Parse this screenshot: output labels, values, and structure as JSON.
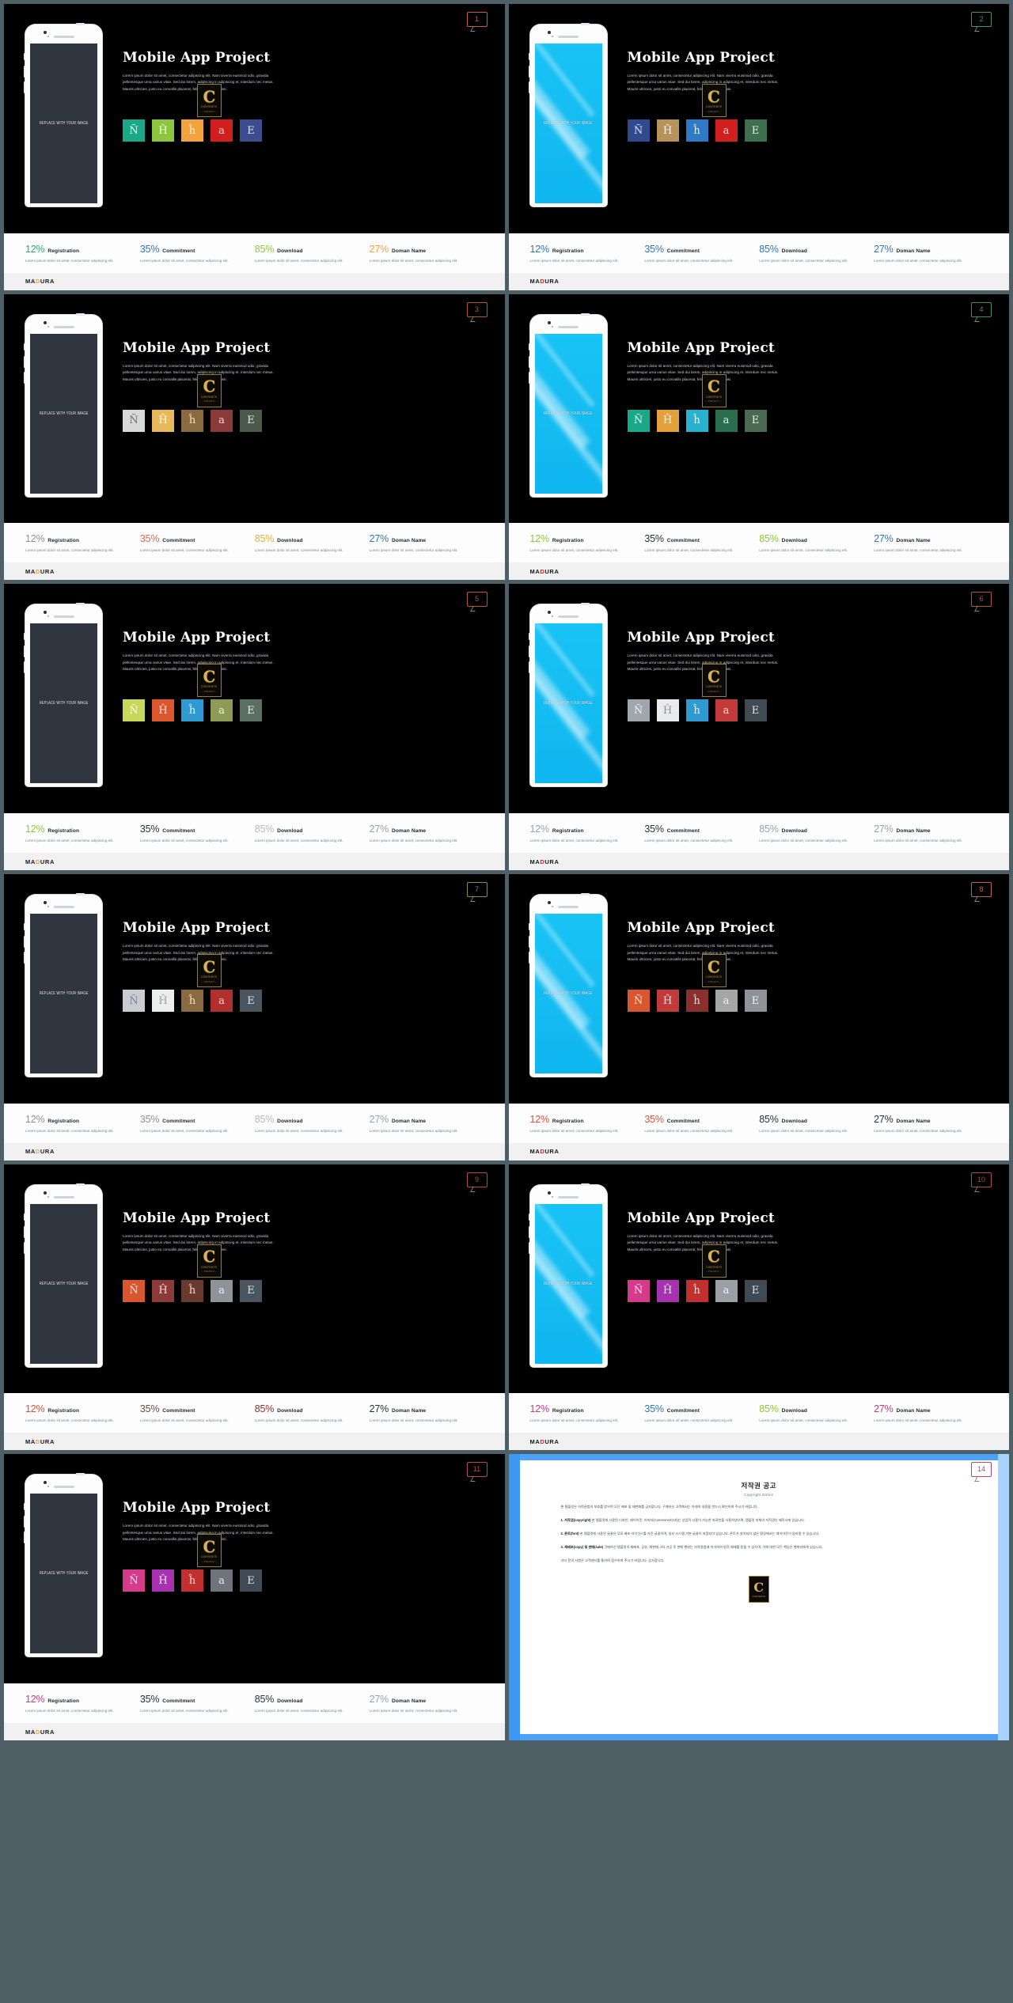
{
  "deck": {
    "title": "Mobile App Project",
    "body_copy": "Lorem ipsum dolor sit amet, consectetur adipiscing elit. Nam viverra euismod odio, gravida pellentesque urna varius vitae. Sed dui lorem, adipiscing in adipiscing et, interdum nec metus. Mauris ultricies, justo eu convallis placerat, felis enim ornare nisi.",
    "phone_label": "REPLACE WITH YOUR IMAGE",
    "brand": {
      "pre": "MA",
      "accent": "D",
      "post": "URA"
    },
    "seal": {
      "letter": "C",
      "line1": "CONTENTS",
      "line2": "~ PRESENT ~"
    },
    "stat_labels": [
      "Registration",
      "Commitment",
      "Download",
      "Doman Name"
    ],
    "stat_values": [
      "12%",
      "35%",
      "85%",
      "27%"
    ],
    "stat_sub": "Lorem ipsum dolor sit amet, consectetur adipiscing elit.",
    "tile_letters": [
      "Ñ",
      "Ĥ",
      "ĥ",
      "a",
      "E"
    ]
  },
  "slides": [
    {
      "badge": "1",
      "badge_color": "#c0643f",
      "screen": "dark",
      "stat_colors": [
        "#2aa876",
        "#2f74b5",
        "#8cc63f",
        "#f2a33c"
      ],
      "tiles": [
        {
          "bg": "#19a888",
          "fg": "#eaf7f3"
        },
        {
          "bg": "#8cc63f",
          "fg": "#f2f9e7"
        },
        {
          "bg": "#f2a33c",
          "fg": "#fff4e4"
        },
        {
          "bg": "#d11f1f",
          "fg": "#ffdcdc"
        },
        {
          "bg": "#3b4d8f",
          "fg": "#dfe4f7"
        }
      ]
    },
    {
      "badge": "2",
      "badge_color": "#4c8f74",
      "screen": "blue",
      "stat_colors": [
        "#2f74b5",
        "#2f74b5",
        "#2f74b5",
        "#2f74b5"
      ],
      "tiles": [
        {
          "bg": "#2f4a8f",
          "fg": "#dfe4f7"
        },
        {
          "bg": "#b7935a",
          "fg": "#fdf6e9"
        },
        {
          "bg": "#2f7ac4",
          "fg": "#e4f0fb"
        },
        {
          "bg": "#d11f1f",
          "fg": "#ffdcdc"
        },
        {
          "bg": "#3f6f4e",
          "fg": "#e2f0e6"
        }
      ]
    },
    {
      "badge": "3",
      "badge_color": "#b0593a",
      "screen": "dark",
      "stat_colors": [
        "#8f8f8f",
        "#d16b5a",
        "#e0b23c",
        "#2f74b5"
      ],
      "tiles": [
        {
          "bg": "#d8d8d8",
          "fg": "#6d6d6d"
        },
        {
          "bg": "#e6b95c",
          "fg": "#fff6e0"
        },
        {
          "bg": "#8a6a3f",
          "fg": "#f0e4d0"
        },
        {
          "bg": "#8b3a3a",
          "fg": "#f5dada"
        },
        {
          "bg": "#4a5a4a",
          "fg": "#e2eae2"
        }
      ]
    },
    {
      "badge": "4",
      "badge_color": "#3e8f63",
      "screen": "blue",
      "stat_colors": [
        "#8cc63f",
        "#2b2f33",
        "#8cc63f",
        "#2f74b5"
      ],
      "tiles": [
        {
          "bg": "#19a888",
          "fg": "#eaf7f3"
        },
        {
          "bg": "#e2a13a",
          "fg": "#fff2dd"
        },
        {
          "bg": "#29b2cf",
          "fg": "#e4f7fb"
        },
        {
          "bg": "#2a6e4e",
          "fg": "#e0f0e7"
        },
        {
          "bg": "#4a6a52",
          "fg": "#e6efe9"
        }
      ]
    },
    {
      "badge": "5",
      "badge_color": "#b0593a",
      "screen": "dark",
      "stat_colors": [
        "#8cc63f",
        "#2b2f33",
        "#b7b7b7",
        "#9aa0a6"
      ],
      "tiles": [
        {
          "bg": "#c8d85a",
          "fg": "#f6f9e2"
        },
        {
          "bg": "#d9562f",
          "fg": "#ffe2d8"
        },
        {
          "bg": "#2f9ad1",
          "fg": "#e2f2fb"
        },
        {
          "bg": "#8e9a58",
          "fg": "#f0f4de"
        },
        {
          "bg": "#5a6f5f",
          "fg": "#e8efea"
        }
      ]
    },
    {
      "badge": "6",
      "badge_color": "#b0593a",
      "screen": "blue",
      "stat_colors": [
        "#9aa0a6",
        "#2b2f33",
        "#9aa0a6",
        "#9aa0a6"
      ],
      "tiles": [
        {
          "bg": "#9fa6ac",
          "fg": "#f0f2f4"
        },
        {
          "bg": "#e9eaec",
          "fg": "#8d9399"
        },
        {
          "bg": "#2f9ad1",
          "fg": "#e2f2fb"
        },
        {
          "bg": "#c33a3a",
          "fg": "#ffdede"
        },
        {
          "bg": "#3f4a55",
          "fg": "#dfe4ea"
        }
      ]
    },
    {
      "badge": "7",
      "badge_color": "#8c8c4a",
      "screen": "dark",
      "stat_colors": [
        "#8f8f8f",
        "#8f8f8f",
        "#b7b7b7",
        "#9aa0a6"
      ],
      "tiles": [
        {
          "bg": "#c9cdd1",
          "fg": "#7d8388"
        },
        {
          "bg": "#eceded",
          "fg": "#9aa0a4"
        },
        {
          "bg": "#8a6a3f",
          "fg": "#f0e4d0"
        },
        {
          "bg": "#b03030",
          "fg": "#ffdada"
        },
        {
          "bg": "#4a5560",
          "fg": "#e1e6eb"
        }
      ]
    },
    {
      "badge": "8",
      "badge_color": "#c0643f",
      "screen": "blue",
      "stat_colors": [
        "#d4543a",
        "#d4543a",
        "#2b2f33",
        "#2b2f33"
      ],
      "tiles": [
        {
          "bg": "#d9562f",
          "fg": "#ffe2d8"
        },
        {
          "bg": "#c33a3a",
          "fg": "#ffdede"
        },
        {
          "bg": "#8b2f2f",
          "fg": "#f7d6d6"
        },
        {
          "bg": "#a6a6a6",
          "fg": "#efefef"
        },
        {
          "bg": "#8d9399",
          "fg": "#f2f4f6"
        }
      ]
    },
    {
      "badge": "9",
      "badge_color": "#b34a4a",
      "screen": "dark",
      "stat_colors": [
        "#d4543a",
        "#6b4a3a",
        "#8b2f2f",
        "#2b2f33"
      ],
      "tiles": [
        {
          "bg": "#d9562f",
          "fg": "#ffe2d8"
        },
        {
          "bg": "#8b3a3a",
          "fg": "#f5dada"
        },
        {
          "bg": "#6b3a2f",
          "fg": "#f0ddd4"
        },
        {
          "bg": "#8d9399",
          "fg": "#f2f4f6"
        },
        {
          "bg": "#4a5560",
          "fg": "#e1e6eb"
        }
      ]
    },
    {
      "badge": "10",
      "badge_color": "#b34a4a",
      "screen": "blue",
      "stat_colors": [
        "#c43a7a",
        "#2f74b5",
        "#8cc63f",
        "#c43a7a"
      ],
      "tiles": [
        {
          "bg": "#d63a8a",
          "fg": "#ffdff0"
        },
        {
          "bg": "#a632b0",
          "fg": "#f6dcf8"
        },
        {
          "bg": "#c12f2f",
          "fg": "#ffdcdc"
        },
        {
          "bg": "#9aa0a6",
          "fg": "#f0f2f4"
        },
        {
          "bg": "#3f4a55",
          "fg": "#dfe4ea"
        }
      ]
    },
    {
      "badge": "11",
      "badge_color": "#b34a4a",
      "screen": "dark",
      "stat_colors": [
        "#c43a7a",
        "#2b2f33",
        "#2b2f33",
        "#9aa0a6"
      ],
      "tiles": [
        {
          "bg": "#d63a8a",
          "fg": "#ffdff0"
        },
        {
          "bg": "#a632b0",
          "fg": "#f6dcf8"
        },
        {
          "bg": "#c12f2f",
          "fg": "#ffdcdc"
        },
        {
          "bg": "#6e7479",
          "fg": "#e9ebed"
        },
        {
          "bg": "#3f4a55",
          "fg": "#dfe4ea"
        }
      ]
    }
  ],
  "doc": {
    "badge": "14",
    "badge_color": "#b3486e",
    "title": "저작권 공고",
    "subtitle": "Copyright Notice",
    "intro": "본 템플릿은 저작권법의 보호를 받으며 무단 배포 및 재판매를 금지합니다. 구매하신 고객께서는 아래의 내용을 반드시 확인하여 주시기 바랍니다.",
    "p1_head": "1. 저작권(copyright)",
    "p1": "본 템플릿에 사용된 디자인, 레이아웃, 이미지(Commons/CC0)는 상업적 사용이 가능한 자료만을 사용하였으며, 템플릿 자체의 저작권은 제작사에 있습니다.",
    "p2_head": "2. 폰트(font)",
    "p2": "본 템플릿에 사용된 글꼴은 무료 배포 라이선스를 가진 글꼴이며, 일부 시스템 기본 글꼴이 포함되어 있습니다. 폰트가 설치되지 않은 환경에서는 레이아웃이 달라질 수 있습니다.",
    "p3_head": "3. 재배포(copy) 및 판매(sale)",
    "p3": "구매하신 템플릿의 재배포, 공유, 재판매, 2차 가공 후 판매 행위는 저작권법에 의거하여 법적 제재를 받을 수 있으며, 이에 대한 모든 책임은 행위자에게 있습니다.",
    "outro": "기타 문의 사항은 고객센터를 통하여 접수하여 주시기 바랍니다. 감사합니다.",
    "seal": {
      "letter": "C",
      "line1": "CONTENTS"
    }
  }
}
